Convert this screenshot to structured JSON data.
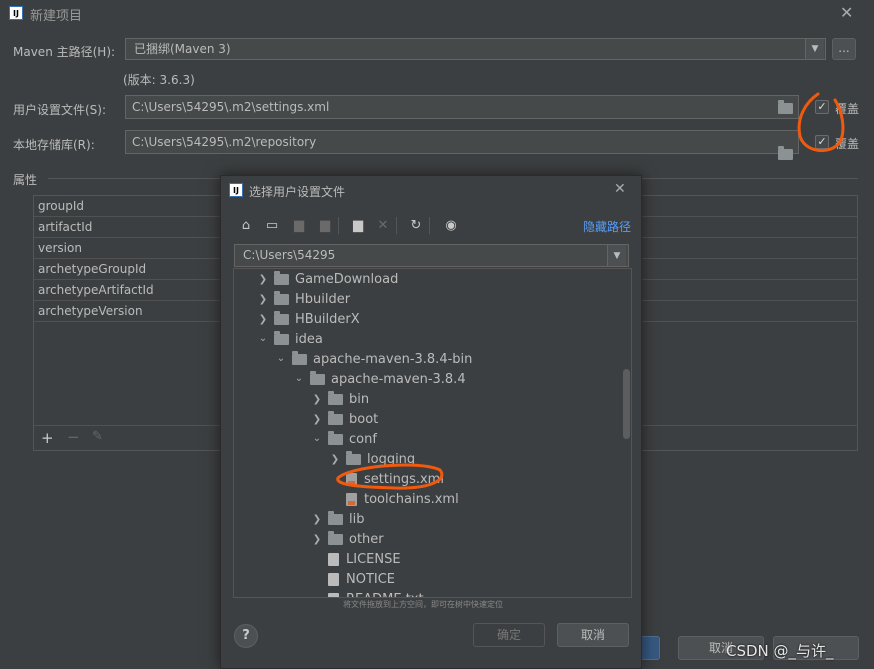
{
  "window": {
    "title": "新建项目",
    "close": "✕"
  },
  "maven": {
    "home_label": "Maven 主路径(H):",
    "home_value": "已捆绑(Maven 3)",
    "browse": "...",
    "version": "(版本: 3.6.3)",
    "settings_label": "用户设置文件(S):",
    "settings_value": "C:\\Users\\54295\\.m2\\settings.xml",
    "settings_override": "覆盖",
    "repo_label": "本地存储库(R):",
    "repo_value": "C:\\Users\\54295\\.m2\\repository",
    "repo_override": "覆盖"
  },
  "properties": {
    "label": "属性",
    "rows": [
      "groupId",
      "artifactId",
      "version",
      "archetypeGroupId",
      "archetypeArtifactId",
      "archetypeVersion"
    ],
    "add": "+",
    "remove": "−",
    "edit": "✎"
  },
  "dialog": {
    "title": "选择用户设置文件",
    "close": "✕",
    "hide_path": "隐藏路径",
    "path": "C:\\Users\\54295",
    "hint": "将文件拖放到上方空间，即可在树中快速定位",
    "ok": "确定",
    "cancel": "取消",
    "help": "?",
    "tree": [
      {
        "label": "GameDownload",
        "depth": 0,
        "kind": "folder",
        "arrow": "right"
      },
      {
        "label": "Hbuilder",
        "depth": 0,
        "kind": "folder",
        "arrow": "right"
      },
      {
        "label": "HBuilderX",
        "depth": 0,
        "kind": "folder",
        "arrow": "right"
      },
      {
        "label": "idea",
        "depth": 0,
        "kind": "folder",
        "arrow": "down"
      },
      {
        "label": "apache-maven-3.8.4-bin",
        "depth": 1,
        "kind": "folder",
        "arrow": "down"
      },
      {
        "label": "apache-maven-3.8.4",
        "depth": 2,
        "kind": "folder",
        "arrow": "down"
      },
      {
        "label": "bin",
        "depth": 3,
        "kind": "folder",
        "arrow": "right"
      },
      {
        "label": "boot",
        "depth": 3,
        "kind": "folder",
        "arrow": "right"
      },
      {
        "label": "conf",
        "depth": 3,
        "kind": "folder",
        "arrow": "down"
      },
      {
        "label": "logging",
        "depth": 4,
        "kind": "folder",
        "arrow": "right"
      },
      {
        "label": "settings.xml",
        "depth": 4,
        "kind": "xml",
        "arrow": ""
      },
      {
        "label": "toolchains.xml",
        "depth": 4,
        "kind": "xml",
        "arrow": ""
      },
      {
        "label": "lib",
        "depth": 3,
        "kind": "folder",
        "arrow": "right"
      },
      {
        "label": "other",
        "depth": 3,
        "kind": "folder",
        "arrow": "right"
      },
      {
        "label": "LICENSE",
        "depth": 3,
        "kind": "file",
        "arrow": ""
      },
      {
        "label": "NOTICE",
        "depth": 3,
        "kind": "file",
        "arrow": ""
      },
      {
        "label": "README.txt",
        "depth": 3,
        "kind": "file",
        "arrow": ""
      }
    ]
  },
  "bottom": {
    "cancel": "取消",
    "watermark": "CSDN @_与许_"
  },
  "colors": {
    "accent": "#589df6",
    "annotation": "#f05a0e"
  }
}
